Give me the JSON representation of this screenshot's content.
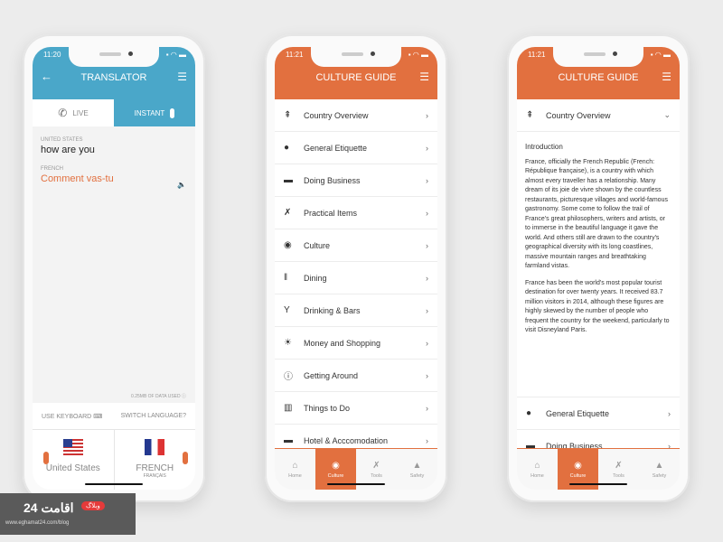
{
  "colors": {
    "translator": "#4aa7c9",
    "culture": "#e2703f"
  },
  "translator": {
    "time": "11:20",
    "title": "TRANSLATOR",
    "tabs": [
      {
        "label": "LIVE",
        "icon": "phone-icon"
      },
      {
        "label": "INSTANT",
        "icon": "microphone-icon"
      }
    ],
    "source_lang": "UNITED STATES",
    "source_text": "how are you",
    "target_lang": "FRENCH",
    "target_text": "Comment vas-tu",
    "data_used": "0.25MB OF DATA USED",
    "use_keyboard": "USE KEYBOARD",
    "switch_language": "SWITCH LANGUAGE?",
    "lang_left": "United States",
    "lang_right": "FRENCH",
    "lang_right_native": "FRANÇAIS"
  },
  "culture": {
    "time": "11:21",
    "title": "CULTURE GUIDE",
    "items": [
      {
        "label": "Country Overview",
        "icon": "signpost-icon",
        "glyph": "⇞"
      },
      {
        "label": "General Etiquette",
        "icon": "etiquette-icon",
        "glyph": "●"
      },
      {
        "label": "Doing Business",
        "icon": "open-sign-icon",
        "glyph": "▬"
      },
      {
        "label": "Practical Items",
        "icon": "tools-icon",
        "glyph": "✗"
      },
      {
        "label": "Culture",
        "icon": "globe-icon",
        "glyph": "◉"
      },
      {
        "label": "Dining",
        "icon": "cutlery-icon",
        "glyph": "ǁ"
      },
      {
        "label": "Drinking & Bars",
        "icon": "cocktail-icon",
        "glyph": "Y"
      },
      {
        "label": "Money and Shopping",
        "icon": "sun-icon",
        "glyph": "☀"
      },
      {
        "label": "Getting Around",
        "icon": "info-icon",
        "glyph": "ⓘ"
      },
      {
        "label": "Things to Do",
        "icon": "map-icon",
        "glyph": "▥"
      },
      {
        "label": "Hotel & Acccomodation",
        "icon": "bed-icon",
        "glyph": "▬"
      }
    ],
    "nav": [
      {
        "label": "Home",
        "glyph": "⌂"
      },
      {
        "label": "Culture",
        "glyph": "◉"
      },
      {
        "label": "Tools",
        "glyph": "✗"
      },
      {
        "label": "Safety",
        "glyph": "▲"
      }
    ]
  },
  "overview": {
    "time": "11:21",
    "title": "CULTURE GUIDE",
    "section": "Country Overview",
    "heading": "Introduction",
    "p1": "France, officially the French Republic (French: République française), is a country with which almost every traveller has a relationship. Many dream of its joie de vivre shown by the countless restaurants, picturesque villages and world-famous gastronomy. Some come to follow the trail of France's great philosophers, writers and artists, or to immerse in the beautiful language it gave the world. And others still are drawn to the country's geographical diversity with its long coastlines, massive mountain ranges and breathtaking farmland vistas.",
    "p2": "France has been the world's most popular tourist destination for over twenty years. It received 83.7 million visitors in 2014, although these figures are highly skewed by the number of people who frequent the country for the weekend, particularly to visit Disneyland Paris.",
    "next1": "General Etiquette",
    "next2": "Doing Business"
  },
  "watermark": {
    "logo": "اقامت 24",
    "badge": "وبلاگ",
    "url": "www.eghamat24.com/blog"
  }
}
